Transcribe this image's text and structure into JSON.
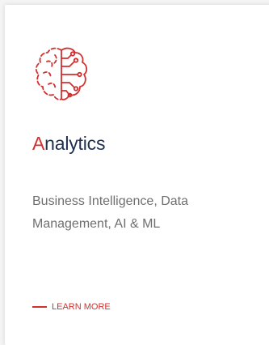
{
  "card": {
    "title_accent": "A",
    "title_rest": "nalytics",
    "description": "Business Intelligence, Data Management, AI & ML",
    "link_label": "LEARN MORE",
    "icon": "brain-circuit-icon"
  },
  "colors": {
    "accent": "#d32f2f",
    "title": "#1f2f4f",
    "text": "#6f6f6f"
  }
}
